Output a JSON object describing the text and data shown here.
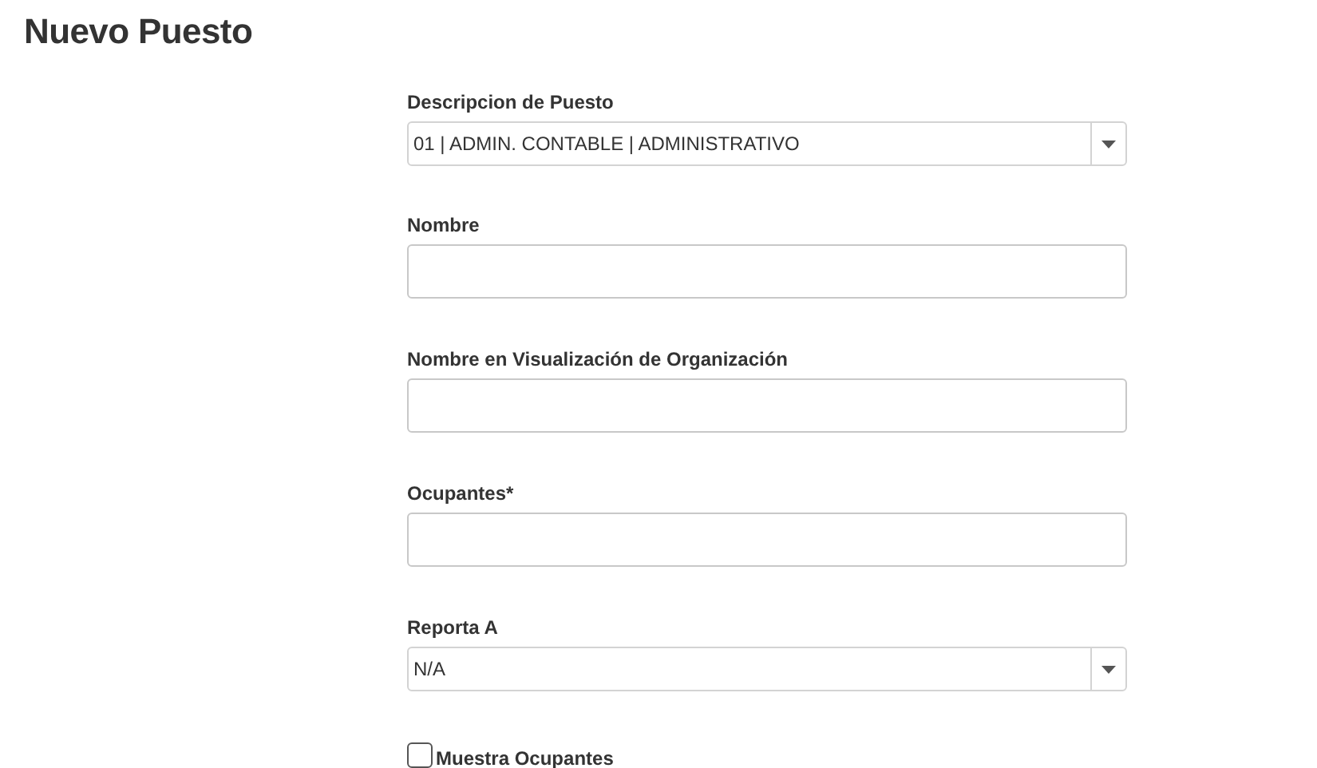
{
  "title": "Nuevo Puesto",
  "fields": [
    {
      "kind": "select",
      "label": "Descripcion de Puesto",
      "value": "01 | ADMIN. CONTABLE | ADMINISTRATIVO"
    },
    {
      "kind": "text",
      "label": "Nombre"
    },
    {
      "kind": "text",
      "label": "Nombre en Visualización de Organización"
    },
    {
      "kind": "text",
      "label": "Ocupantes*"
    },
    {
      "kind": "select",
      "label": "Reporta A",
      "value": "N/A"
    },
    {
      "kind": "checkbox",
      "label": "Muestra Ocupantes",
      "checked": false
    }
  ]
}
